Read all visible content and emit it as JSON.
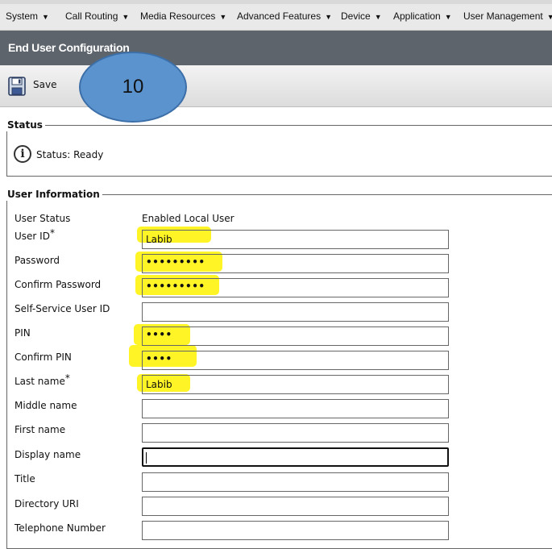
{
  "menu": {
    "items": [
      {
        "label": "System"
      },
      {
        "label": "Call Routing"
      },
      {
        "label": "Media Resources"
      },
      {
        "label": "Advanced Features"
      },
      {
        "label": "Device"
      },
      {
        "label": "Application"
      },
      {
        "label": "User Management"
      }
    ],
    "caret": "▼"
  },
  "page": {
    "title": "End User Configuration"
  },
  "toolbar": {
    "save_label": "Save"
  },
  "step_marker": "10",
  "status": {
    "legend": "Status",
    "text": "Status: Ready"
  },
  "user_info": {
    "legend": "User Information",
    "user_status": {
      "label": "User Status",
      "value": "Enabled Local User"
    },
    "fields": [
      {
        "label": "User ID",
        "required": "*",
        "value": "Labib"
      },
      {
        "label": "Password",
        "value": "•••••••••"
      },
      {
        "label": "Confirm Password",
        "value": "•••••••••"
      },
      {
        "label": "Self-Service User ID",
        "value": ""
      },
      {
        "label": "PIN",
        "value": "••••"
      },
      {
        "label": "Confirm PIN",
        "value": "••••"
      },
      {
        "label": "Last name",
        "required": "*",
        "value": "Labib"
      },
      {
        "label": "Middle name",
        "value": ""
      },
      {
        "label": "First name",
        "value": ""
      },
      {
        "label": "Display name",
        "value": ""
      },
      {
        "label": "Title",
        "value": ""
      },
      {
        "label": "Directory URI",
        "value": ""
      },
      {
        "label": "Telephone Number",
        "value": ""
      }
    ]
  },
  "colors": {
    "title_band": "#5d646c",
    "highlight": "#fff200",
    "step_circle": "#5b93cf"
  }
}
